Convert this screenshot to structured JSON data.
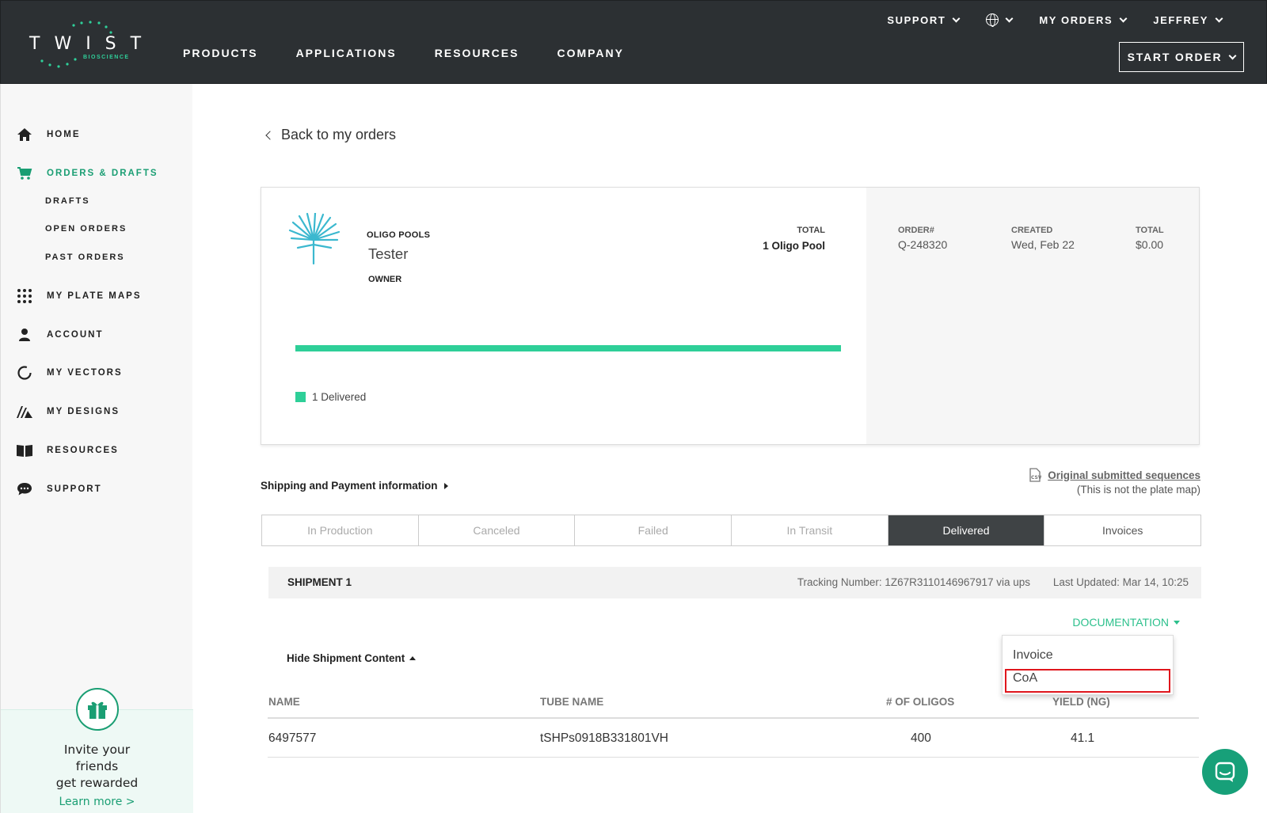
{
  "header": {
    "logo_text": "TWIST",
    "logo_sub": "BIOSCIENCE",
    "nav": [
      "PRODUCTS",
      "APPLICATIONS",
      "RESOURCES",
      "COMPANY"
    ],
    "support": "SUPPORT",
    "my_orders": "MY ORDERS",
    "user": "JEFFREY",
    "start_order": "START ORDER",
    "colors": {
      "bar": "#2c3033",
      "accent": "#2fd09a"
    }
  },
  "sidebar": {
    "items": [
      {
        "label": "HOME",
        "icon": "home-icon"
      },
      {
        "label": "ORDERS & DRAFTS",
        "icon": "cart-icon",
        "active": true
      },
      {
        "label": "MY PLATE MAPS",
        "icon": "grid-dots-icon"
      },
      {
        "label": "ACCOUNT",
        "icon": "user-icon"
      },
      {
        "label": "MY VECTORS",
        "icon": "vector-ring-icon"
      },
      {
        "label": "MY DESIGNS",
        "icon": "designs-icon"
      },
      {
        "label": "RESOURCES",
        "icon": "book-icon"
      },
      {
        "label": "SUPPORT",
        "icon": "chat-bubble-icon"
      }
    ],
    "sub": [
      "DRAFTS",
      "OPEN ORDERS",
      "PAST ORDERS"
    ],
    "refer": {
      "l1": "Invite your",
      "l2": "friends",
      "l3": "get rewarded",
      "link": "Learn more >"
    }
  },
  "main": {
    "back": "Back to my orders",
    "card": {
      "type": "OLIGO POOLS",
      "name": "Tester",
      "owner": "OWNER",
      "total_label": "TOTAL",
      "total_value": "1 Oligo Pool",
      "progress_fraction": 1.0,
      "legend": "1 Delivered",
      "order_label": "ORDER#",
      "order_value": "Q-248320",
      "created_label": "CREATED",
      "created_value": "Wed, Feb 22",
      "total2_label": "TOTAL",
      "total2_value": "$0.00"
    },
    "shipping_payment": "Shipping and Payment information",
    "original_link": "Original submitted sequences",
    "original_note": "(This is not the plate map)",
    "tabs": [
      {
        "label": "In Production"
      },
      {
        "label": "Canceled"
      },
      {
        "label": "Failed"
      },
      {
        "label": "In Transit"
      },
      {
        "label": "Delivered",
        "active": true
      },
      {
        "label": "Invoices"
      }
    ],
    "shipment": {
      "title": "SHIPMENT 1",
      "tracking": "Tracking Number: 1Z67R3110146967917 via ups",
      "updated": "Last Updated: Mar 14, 10:25"
    },
    "documentation": "DOCUMENTATION",
    "doc_menu": [
      "Invoice",
      "CoA"
    ],
    "hide_content": "Hide Shipment Content",
    "table": {
      "headers": [
        "NAME",
        "TUBE NAME",
        "# OF OLIGOS",
        "YIELD (NG)"
      ],
      "rows": [
        [
          "6497577",
          "tSHPs0918B331801VH",
          "400",
          "41.1"
        ]
      ]
    }
  }
}
